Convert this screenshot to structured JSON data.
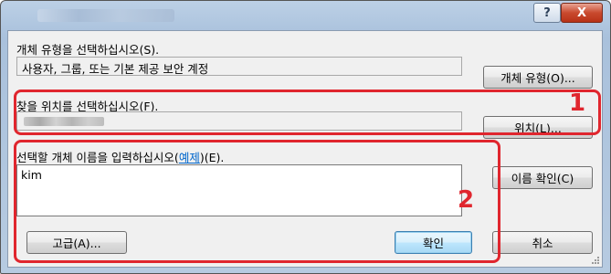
{
  "window": {
    "help_label": "?",
    "close_label": "X"
  },
  "object_type": {
    "label": "개체 유형을 선택하십시오(S).",
    "value": "사용자, 그룹, 또는 기본 제공 보안 계정",
    "button": "개체 유형(O)..."
  },
  "location": {
    "label": "찾을 위치를 선택하십시오(F).",
    "button": "위치(L)..."
  },
  "object_name": {
    "label_prefix": "선택할 개체 이름을 입력하십시오(",
    "example_link": "예제",
    "label_suffix": ")(E).",
    "value": "kim",
    "check_names_button": "이름 확인(C)"
  },
  "buttons": {
    "advanced": "고급(A)...",
    "ok": "확인",
    "cancel": "취소"
  },
  "annotations": {
    "marker1": "1",
    "marker2": "2",
    "color": "#e0262e"
  }
}
